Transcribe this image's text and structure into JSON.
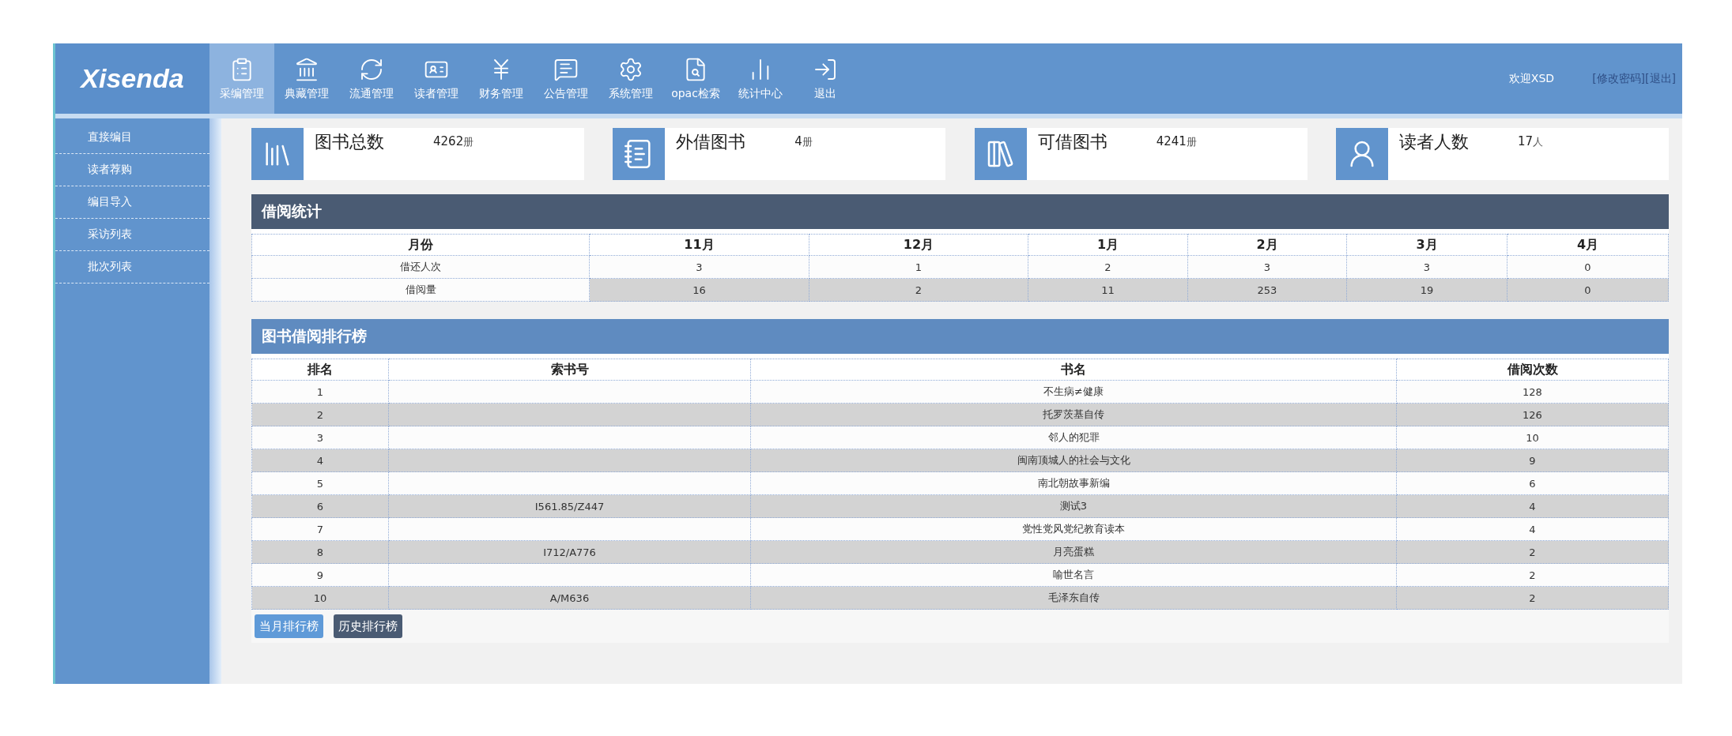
{
  "logo": "Xisenda",
  "nav": [
    {
      "label": "采编管理",
      "selected": true
    },
    {
      "label": "典藏管理",
      "selected": false
    },
    {
      "label": "流通管理",
      "selected": false
    },
    {
      "label": "读者管理",
      "selected": false
    },
    {
      "label": "财务管理",
      "selected": false
    },
    {
      "label": "公告管理",
      "selected": false
    },
    {
      "label": "系统管理",
      "selected": false
    },
    {
      "label": "opac检索",
      "selected": false
    },
    {
      "label": "统计中心",
      "selected": false
    },
    {
      "label": "退出",
      "selected": false
    }
  ],
  "user": {
    "welcome": "欢迎XSD",
    "links": [
      "[修改密码]",
      "[退出]"
    ]
  },
  "sidebar": {
    "items": [
      "直接编目",
      "读者荐购",
      "编目导入",
      "采访列表",
      "批次列表"
    ]
  },
  "stats": [
    {
      "label": "图书总数",
      "value": "4262",
      "unit": "册"
    },
    {
      "label": "外借图书",
      "value": "4",
      "unit": "册"
    },
    {
      "label": "可借图书",
      "value": "4241",
      "unit": "册"
    },
    {
      "label": "读者人数",
      "value": "17",
      "unit": "人"
    }
  ],
  "borrow_stats": {
    "title": "借阅统计",
    "columns": [
      "月份",
      "11月",
      "12月",
      "1月",
      "2月",
      "3月",
      "4月"
    ],
    "rows": [
      [
        "借还人次",
        "3",
        "1",
        "2",
        "3",
        "3",
        "0"
      ],
      [
        "借阅量",
        "16",
        "2",
        "11",
        "253",
        "19",
        "0"
      ]
    ]
  },
  "ranking": {
    "title": "图书借阅排行榜",
    "columns": [
      "排名",
      "索书号",
      "书名",
      "借阅次数"
    ],
    "rows": [
      [
        "1",
        "",
        "不生病≠健康",
        "128"
      ],
      [
        "2",
        "",
        "托罗茨基自传",
        "126"
      ],
      [
        "3",
        "",
        "邻人的犯罪",
        "10"
      ],
      [
        "4",
        "",
        "闽南顶城人的社会与文化",
        "9"
      ],
      [
        "5",
        "",
        "南北朝故事新编",
        "6"
      ],
      [
        "6",
        "I561.85/Z447",
        "测试3",
        "4"
      ],
      [
        "7",
        "",
        "党性党风党纪教育读本",
        "4"
      ],
      [
        "8",
        "I712/A776",
        "月亮蛋糕",
        "2"
      ],
      [
        "9",
        "",
        "喻世名言",
        "2"
      ],
      [
        "10",
        "A/M636",
        "毛泽东自传",
        "2"
      ]
    ],
    "buttons": [
      {
        "label": "当月排行榜",
        "selected": true
      },
      {
        "label": "历史排行榜",
        "selected": false
      }
    ]
  }
}
